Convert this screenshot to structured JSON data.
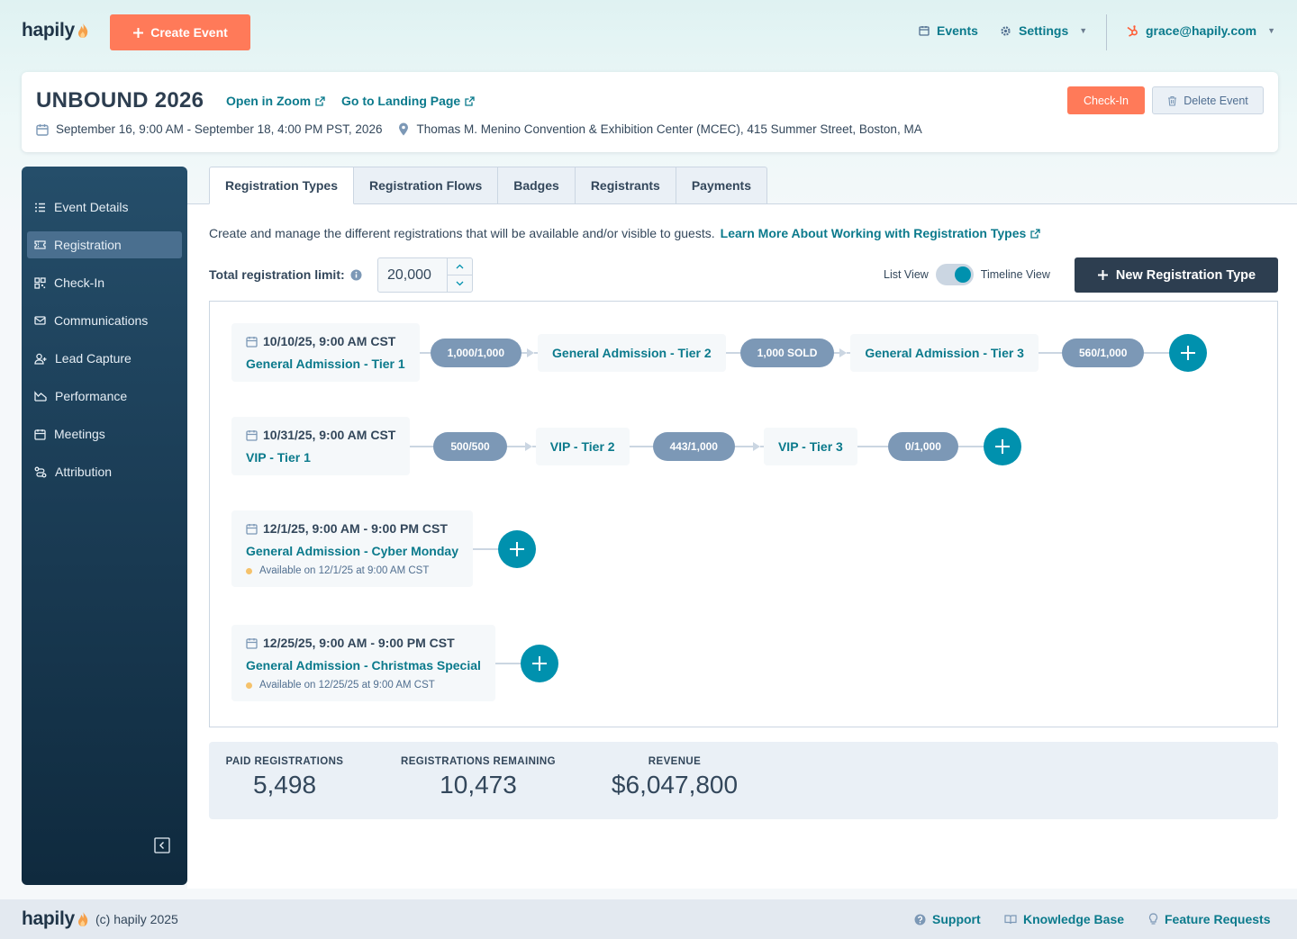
{
  "brand": {
    "logo_text": "hapily",
    "accent": "#ff7a59",
    "teal": "#0091ae",
    "link": "#0b7a8c",
    "navy": "#2d3e50"
  },
  "topbar": {
    "create_event_label": "Create Event",
    "events_label": "Events",
    "settings_label": "Settings",
    "user_email": "grace@hapily.com"
  },
  "event": {
    "title": "UNBOUND 2026",
    "open_zoom_label": "Open in Zoom",
    "landing_page_label": "Go to Landing Page",
    "dates": "September 16, 9:00 AM - September 18, 4:00 PM PST, 2026",
    "location": "Thomas M. Menino Convention & Exhibition Center (MCEC), 415 Summer Street, Boston, MA",
    "checkin_label": "Check-In",
    "delete_label": "Delete Event"
  },
  "sidebar": {
    "items": [
      {
        "label": "Event Details",
        "icon": "list-icon"
      },
      {
        "label": "Registration",
        "icon": "ticket-icon",
        "active": true
      },
      {
        "label": "Check-In",
        "icon": "qr-icon"
      },
      {
        "label": "Communications",
        "icon": "mail-icon"
      },
      {
        "label": "Lead Capture",
        "icon": "user-plus-icon"
      },
      {
        "label": "Performance",
        "icon": "chart-icon"
      },
      {
        "label": "Meetings",
        "icon": "calendar-icon"
      },
      {
        "label": "Attribution",
        "icon": "attribution-icon"
      }
    ]
  },
  "tabs": [
    {
      "label": "Registration Types",
      "active": true
    },
    {
      "label": "Registration Flows"
    },
    {
      "label": "Badges"
    },
    {
      "label": "Registrants"
    },
    {
      "label": "Payments"
    }
  ],
  "content": {
    "description": "Create and manage the different registrations that will be available and/or visible to guests.",
    "learn_more_label": "Learn More About Working with Registration Types",
    "limit_label": "Total registration limit:",
    "limit_value": "20,000",
    "list_view_label": "List View",
    "timeline_view_label": "Timeline View",
    "timeline_view_selected": true,
    "new_type_label": "New Registration Type"
  },
  "timeline": {
    "rows": [
      {
        "date": "10/10/25, 9:00 AM CST",
        "first": "General Admission - Tier 1",
        "first_count": "1,000/1,000",
        "tiers": [
          {
            "name": "General Admission - Tier 2",
            "count": "1,000 SOLD"
          },
          {
            "name": "General Admission - Tier 3",
            "count": "560/1,000"
          }
        ]
      },
      {
        "date": "10/31/25, 9:00 AM CST",
        "first": "VIP - Tier 1",
        "first_count": "500/500",
        "tiers": [
          {
            "name": "VIP - Tier 2",
            "count": "443/1,000"
          },
          {
            "name": "VIP - Tier 3",
            "count": "0/1,000"
          }
        ]
      },
      {
        "date": "12/1/25, 9:00 AM - 9:00 PM CST",
        "first": "General Admission - Cyber Monday",
        "available": "Available on 12/1/25 at 9:00 AM CST"
      },
      {
        "date": "12/25/25, 9:00 AM - 9:00 PM CST",
        "first": "General Admission - Christmas Special",
        "available": "Available on 12/25/25 at 9:00 AM CST"
      }
    ]
  },
  "stats": {
    "paid_label": "PAID REGISTRATIONS",
    "paid_value": "5,498",
    "remaining_label": "REGISTRATIONS REMAINING",
    "remaining_value": "10,473",
    "revenue_label": "REVENUE",
    "revenue_value": "$6,047,800"
  },
  "footer": {
    "copyright": "(c) hapily 2025",
    "support_label": "Support",
    "kb_label": "Knowledge Base",
    "feature_label": "Feature Requests"
  }
}
